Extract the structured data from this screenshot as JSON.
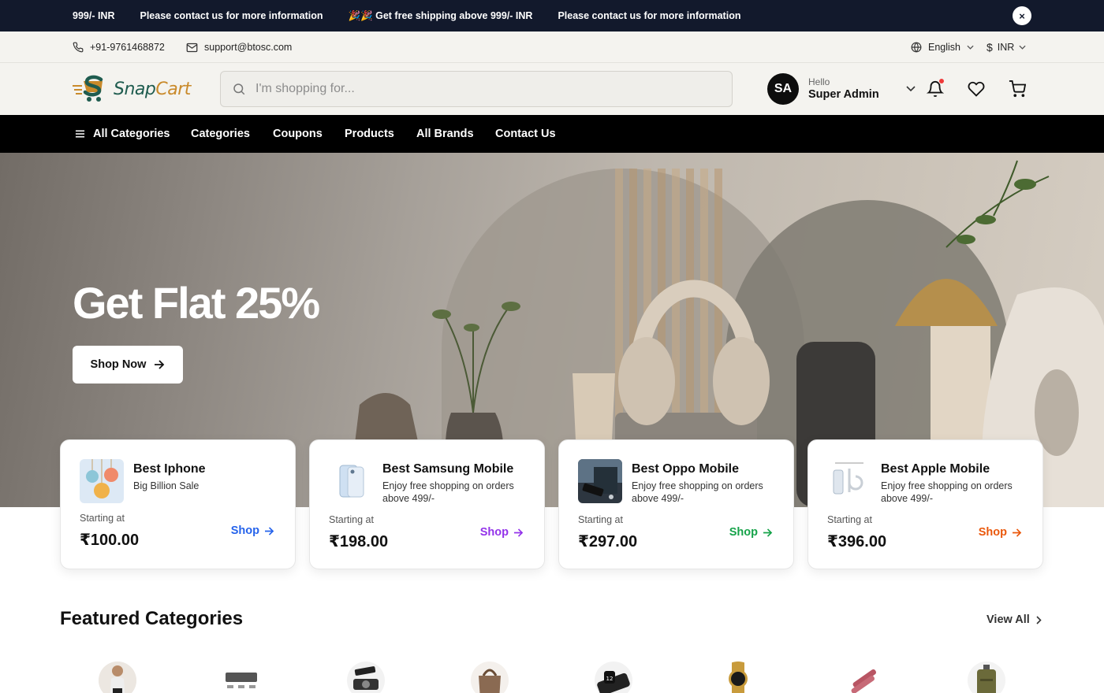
{
  "announcement": {
    "messages": [
      "999/- INR",
      "Please contact us for more information",
      "🎉🎉 Get free shipping above 999/- INR",
      "Please contact us for more information"
    ],
    "close_label": "×"
  },
  "contact": {
    "phone": "+91-9761468872",
    "email": "support@btosc.com",
    "language": "English",
    "currency": "INR"
  },
  "header": {
    "logo_word_1": "Snap",
    "logo_word_2": "Cart",
    "search_placeholder": "I'm shopping for...",
    "user_initials": "SA",
    "user_greeting": "Hello",
    "user_name": "Super Admin"
  },
  "nav": {
    "all_categories": "All Categories",
    "links": [
      "Categories",
      "Coupons",
      "Products",
      "All Brands",
      "Contact Us"
    ]
  },
  "hero": {
    "headline": "Get Flat 25%",
    "cta": "Shop Now"
  },
  "cards": [
    {
      "title": "Best Iphone",
      "subtitle": "Big Billion Sale",
      "starting_label": "Starting at",
      "price": "₹100.00",
      "shop_label": "Shop",
      "color": "#2563eb"
    },
    {
      "title": "Best Samsung Mobile",
      "subtitle": "Enjoy free shopping on orders above 499/-",
      "starting_label": "Starting at",
      "price": "₹198.00",
      "shop_label": "Shop",
      "color": "#9333ea"
    },
    {
      "title": "Best Oppo Mobile",
      "subtitle": "Enjoy free shopping on orders above 499/-",
      "starting_label": "Starting at",
      "price": "₹297.00",
      "shop_label": "Shop",
      "color": "#16a34a"
    },
    {
      "title": "Best Apple Mobile",
      "subtitle": "Enjoy free shopping on orders above 499/-",
      "starting_label": "Starting at",
      "price": "₹396.00",
      "shop_label": "Shop",
      "color": "#ea580c"
    }
  ],
  "featured": {
    "title": "Featured Categories",
    "view_all": "View All",
    "icons": [
      "fashion-category-icon",
      "keyboard-category-icon",
      "camera-category-icon",
      "handbag-category-icon",
      "smartwatch-category-icon",
      "wristwatch-category-icon",
      "cosmetics-category-icon",
      "luggage-category-icon"
    ]
  },
  "colors": {
    "announcement_bg": "#12192c",
    "nav_bg": "#000000",
    "header_bg": "#f4f3ef",
    "logo_gold": "#c98a2b",
    "logo_green": "#1f5c4f",
    "notification_dot": "#ef3a3a"
  }
}
